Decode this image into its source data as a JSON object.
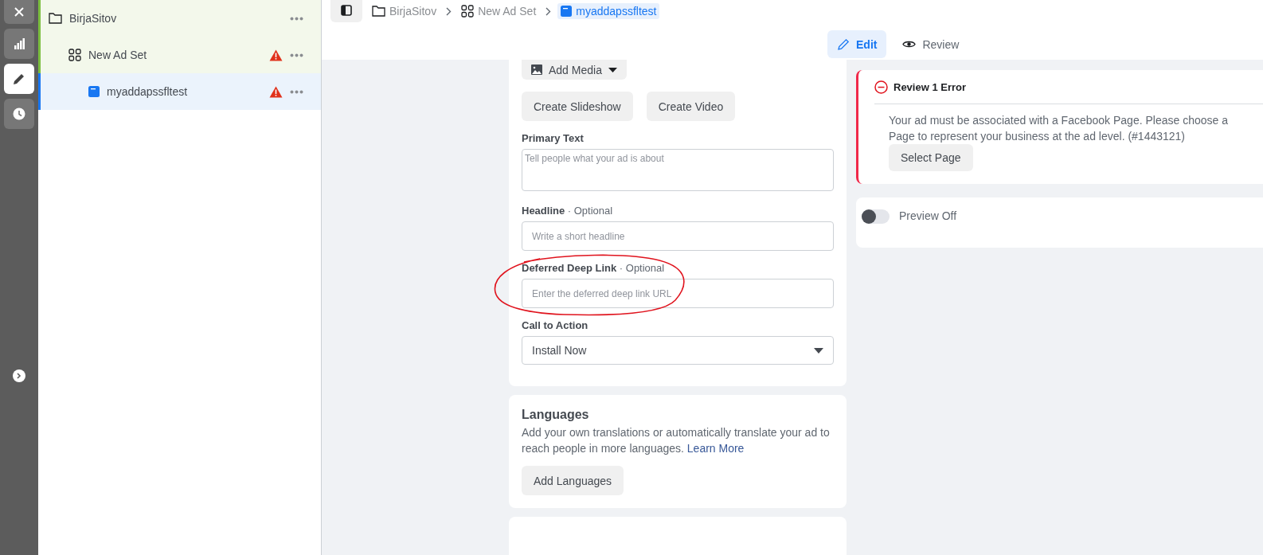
{
  "rail": {
    "items": [
      {
        "kind": "close",
        "selected": false
      },
      {
        "kind": "chart",
        "selected": false
      },
      {
        "kind": "pencil",
        "selected": true
      },
      {
        "kind": "clock",
        "selected": false
      }
    ]
  },
  "tree": [
    {
      "label": "BirjaSitov",
      "kind": "campaign",
      "warning": false,
      "selected": false,
      "children": [
        {
          "label": "New Ad Set",
          "kind": "adset",
          "warning": true,
          "selected": false,
          "children": [
            {
              "label": "myaddapssfltest",
              "kind": "ad",
              "warning": true,
              "selected": true
            }
          ]
        }
      ]
    }
  ],
  "breadcrumbs": [
    {
      "label": "BirjaSitov",
      "kind": "campaign",
      "selected": false
    },
    {
      "label": "New Ad Set",
      "kind": "adset",
      "selected": false
    },
    {
      "label": "myaddapssfltest",
      "kind": "ad",
      "selected": true
    }
  ],
  "view_tabs": [
    {
      "label": "Edit",
      "kind": "pencil",
      "selected": true
    },
    {
      "label": "Review",
      "kind": "eye",
      "selected": false
    }
  ],
  "creative": {
    "add_media": "Add Media",
    "buttons": [
      "Create Slideshow",
      "Create Video"
    ],
    "fields": [
      {
        "label": "Primary Text",
        "kind": "textarea",
        "placeholder": "Tell people what your ad is about",
        "annotated": false
      },
      {
        "label": "Headline",
        "optional": "· Optional",
        "kind": "input",
        "placeholder": "Write a short headline",
        "annotated": false
      },
      {
        "label": "Deferred Deep Link",
        "optional": "· Optional",
        "kind": "input",
        "placeholder": "Enter the deferred deep link URL",
        "annotated": true
      },
      {
        "label": "Call to Action",
        "kind": "select",
        "value": "Install Now",
        "annotated": false
      }
    ]
  },
  "languages": {
    "title": "Languages",
    "text": "Add your own translations or automatically translate your ad to reach people in more languages.",
    "link": "Learn More",
    "button": "Add Languages"
  },
  "review": {
    "title": "Review 1 Error",
    "message": "Your ad must be associated with a Facebook Page. Please choose a Page to represent your business at the ad level. (#1443121)",
    "button": "Select Page"
  },
  "preview": {
    "label": "Preview Off",
    "on": false
  }
}
